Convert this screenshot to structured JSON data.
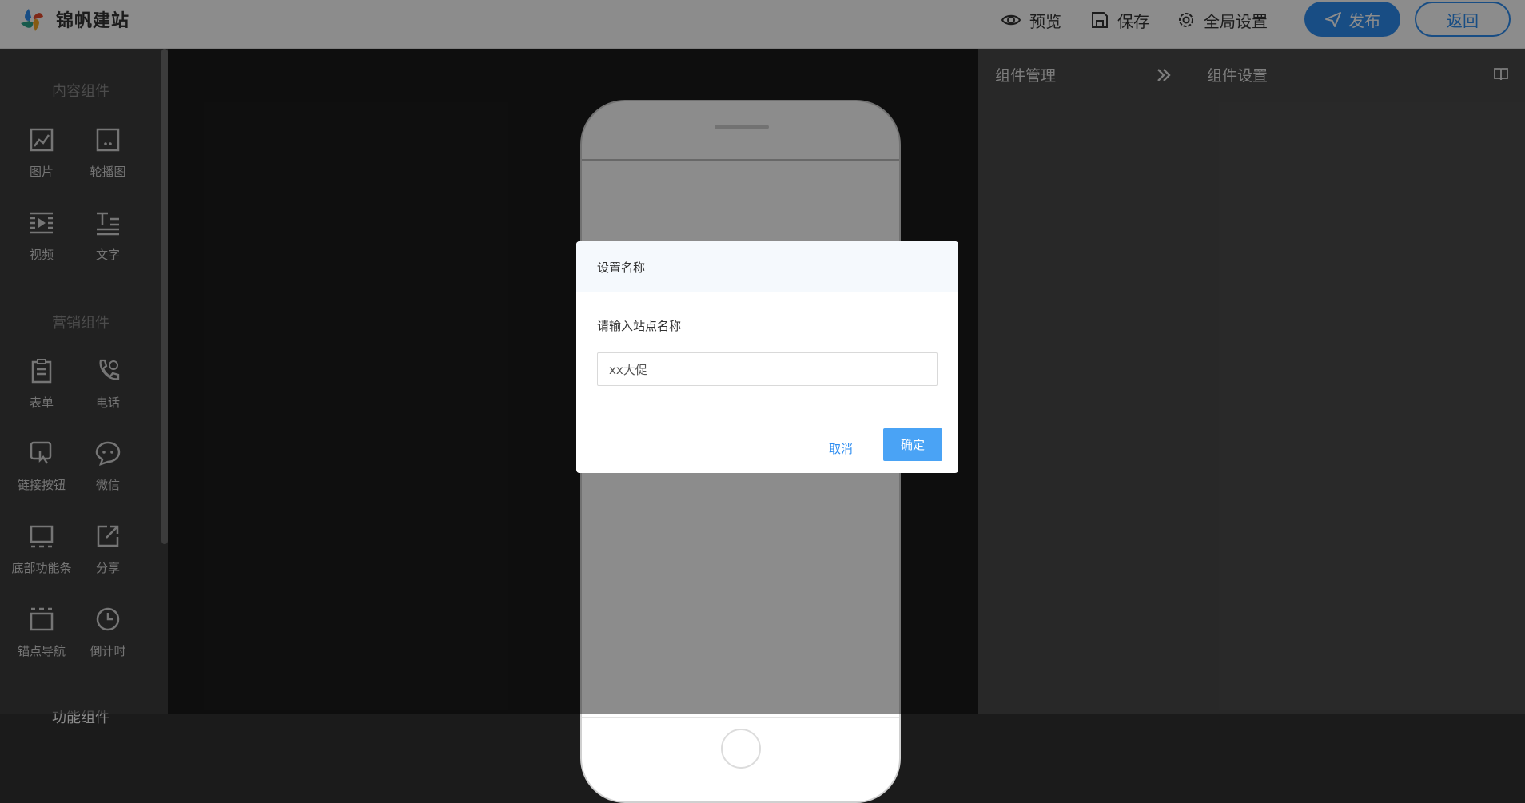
{
  "header": {
    "brand": "锦帆建站",
    "actions": {
      "preview": "预览",
      "save": "保存",
      "global_settings": "全局设置"
    },
    "publish_label": "发布",
    "back_label": "返回"
  },
  "sidebar": {
    "sections": [
      {
        "title": "内容组件"
      },
      {
        "title": "营销组件"
      },
      {
        "title": "功能组件"
      }
    ],
    "items": [
      {
        "label": "图片",
        "icon": "image-icon"
      },
      {
        "label": "轮播图",
        "icon": "carousel-icon"
      },
      {
        "label": "视频",
        "icon": "video-icon"
      },
      {
        "label": "文字",
        "icon": "text-icon"
      },
      {
        "label": "表单",
        "icon": "form-icon"
      },
      {
        "label": "电话",
        "icon": "phone-icon"
      },
      {
        "label": "链接按钮",
        "icon": "link-button-icon"
      },
      {
        "label": "微信",
        "icon": "wechat-icon"
      },
      {
        "label": "底部功能条",
        "icon": "bottom-bar-icon"
      },
      {
        "label": "分享",
        "icon": "share-icon"
      },
      {
        "label": "锚点导航",
        "icon": "anchor-nav-icon"
      },
      {
        "label": "倒计时",
        "icon": "countdown-icon"
      }
    ]
  },
  "panels": {
    "manager_title": "组件管理",
    "settings_title": "组件设置"
  },
  "dialog": {
    "title": "设置名称",
    "label": "请输入站点名称",
    "input_value": "xx大促",
    "cancel_label": "取消",
    "ok_label": "确定"
  },
  "colors": {
    "accent": "#2d8cf0",
    "ok_button": "#4aa3f5"
  }
}
